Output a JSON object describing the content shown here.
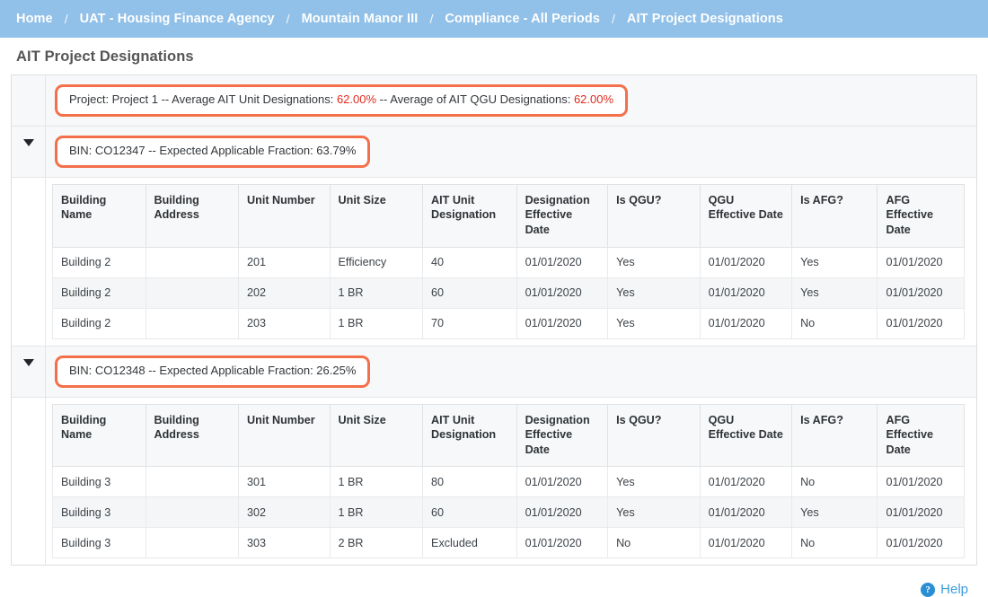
{
  "breadcrumb": {
    "separator": "/",
    "items": [
      {
        "label": "Home"
      },
      {
        "label": "UAT - Housing Finance Agency"
      },
      {
        "label": "Mountain Manor III"
      },
      {
        "label": "Compliance - All Periods"
      },
      {
        "label": "AIT Project Designations"
      }
    ]
  },
  "page": {
    "title": "AIT Project Designations"
  },
  "project_summary": {
    "prefix": "Project: Project 1 -- Average AIT Unit Designations: ",
    "value1": "62.00%",
    "middle": " -- Average of AIT QGU Designations: ",
    "value2": "62.00%"
  },
  "columns": [
    "Building Name",
    "Building Address",
    "Unit Number",
    "Unit Size",
    "AIT Unit Designation",
    "Designation Effective Date",
    "Is QGU?",
    "QGU Effective Date",
    "Is AFG?",
    "AFG Effective Date"
  ],
  "sections": [
    {
      "header": "BIN: CO12347 -- Expected Applicable Fraction: 63.79%",
      "expanded": true,
      "rows": [
        {
          "building_name": "Building 2",
          "building_address": "",
          "unit_number": "201",
          "unit_size": "Efficiency",
          "ait_unit_designation": "40",
          "designation_effective_date": "01/01/2020",
          "is_qgu": "Yes",
          "qgu_effective_date": "01/01/2020",
          "is_afg": "Yes",
          "afg_effective_date": "01/01/2020"
        },
        {
          "building_name": "Building 2",
          "building_address": "",
          "unit_number": "202",
          "unit_size": "1 BR",
          "ait_unit_designation": "60",
          "designation_effective_date": "01/01/2020",
          "is_qgu": "Yes",
          "qgu_effective_date": "01/01/2020",
          "is_afg": "Yes",
          "afg_effective_date": "01/01/2020"
        },
        {
          "building_name": "Building 2",
          "building_address": "",
          "unit_number": "203",
          "unit_size": "1 BR",
          "ait_unit_designation": "70",
          "designation_effective_date": "01/01/2020",
          "is_qgu": "Yes",
          "qgu_effective_date": "01/01/2020",
          "is_afg": "No",
          "afg_effective_date": "01/01/2020"
        }
      ]
    },
    {
      "header": "BIN: CO12348 -- Expected Applicable Fraction: 26.25%",
      "expanded": true,
      "rows": [
        {
          "building_name": "Building 3",
          "building_address": "",
          "unit_number": "301",
          "unit_size": "1 BR",
          "ait_unit_designation": "80",
          "designation_effective_date": "01/01/2020",
          "is_qgu": "Yes",
          "qgu_effective_date": "01/01/2020",
          "is_afg": "No",
          "afg_effective_date": "01/01/2020"
        },
        {
          "building_name": "Building 3",
          "building_address": "",
          "unit_number": "302",
          "unit_size": "1 BR",
          "ait_unit_designation": "60",
          "designation_effective_date": "01/01/2020",
          "is_qgu": "Yes",
          "qgu_effective_date": "01/01/2020",
          "is_afg": "Yes",
          "afg_effective_date": "01/01/2020"
        },
        {
          "building_name": "Building 3",
          "building_address": "",
          "unit_number": "303",
          "unit_size": "2 BR",
          "ait_unit_designation": "Excluded",
          "designation_effective_date": "01/01/2020",
          "is_qgu": "No",
          "qgu_effective_date": "01/01/2020",
          "is_afg": "No",
          "afg_effective_date": "01/01/2020"
        }
      ]
    }
  ],
  "footer": {
    "help_label": "Help",
    "help_icon_glyph": "?"
  },
  "colors": {
    "breadcrumb_bg": "#91c0e8",
    "pill_border": "#f4704a",
    "highlight_text": "#e02b1d",
    "link_blue": "#3b9ddd"
  }
}
